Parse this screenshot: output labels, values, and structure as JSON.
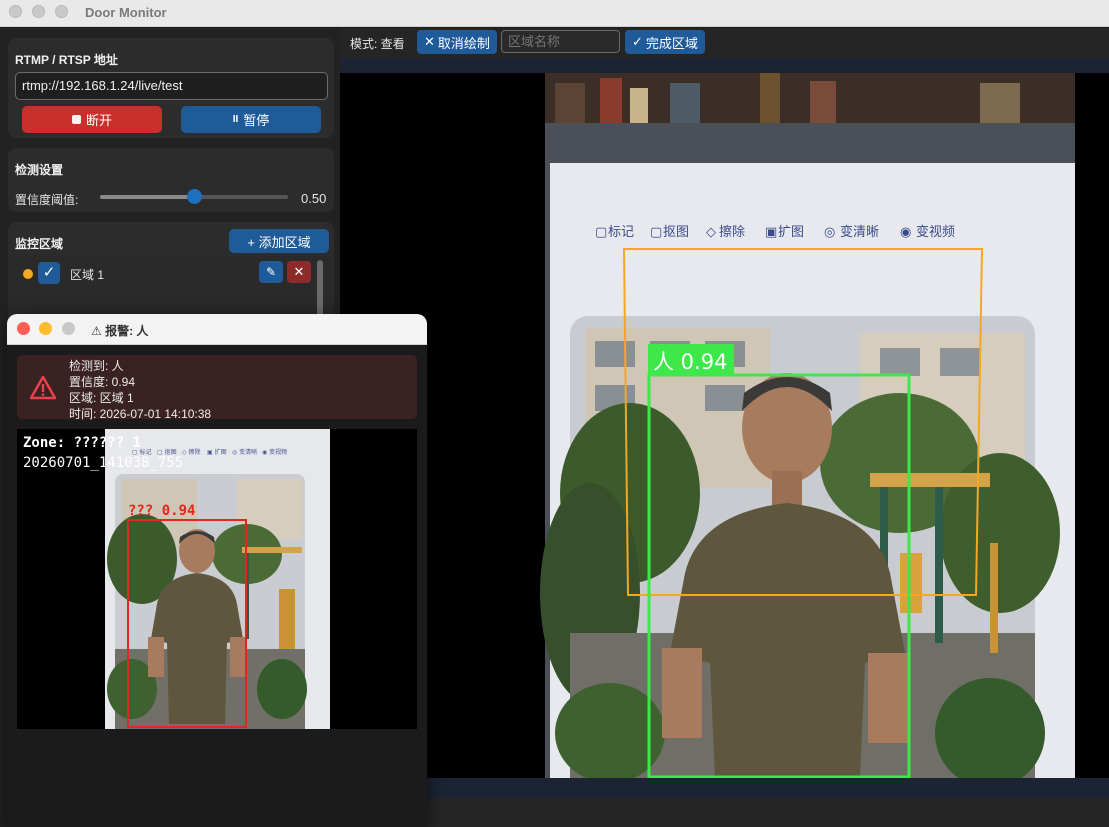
{
  "window": {
    "title": "Door Monitor"
  },
  "sidebar": {
    "stream": {
      "title": "RTMP / RTSP 地址",
      "url": "rtmp://192.168.1.24/live/test",
      "disconnect_label": "断开",
      "pause_label": "暂停"
    },
    "detection": {
      "title": "检测设置",
      "threshold_label": "置信度阈值:",
      "threshold_value": "0.50",
      "threshold_fraction": 0.5
    },
    "zones": {
      "title": "监控区域",
      "add_label": "+ 添加区域",
      "items": [
        {
          "label": "区域 1",
          "color": "#f5a623",
          "enabled": true
        }
      ]
    }
  },
  "toolbar": {
    "mode_label": "模式: 查看",
    "cancel_label": "取消绘制",
    "zone_name_placeholder": "区域名称",
    "finish_label": "完成区域"
  },
  "video": {
    "detection_label": "人 0.94",
    "zone_color": "#f5a623",
    "person_box_color": "#3ee84a",
    "tabs": [
      "标记",
      "抠图",
      "擦除",
      "扩图",
      "变清晰",
      "变视频"
    ]
  },
  "alert": {
    "title": "⚠ 报警: 人",
    "detected": "检测到: 人",
    "confidence": "置信度: 0.94",
    "zone": "区域: 区域 1",
    "time": "时间: 2026-07-01 14:10:38",
    "snapshot": {
      "zone_text": "Zone: ?????? 1",
      "stamp": "20260701_141038_755",
      "box_label": "??? 0.94",
      "box_color": "#e0281e"
    }
  }
}
